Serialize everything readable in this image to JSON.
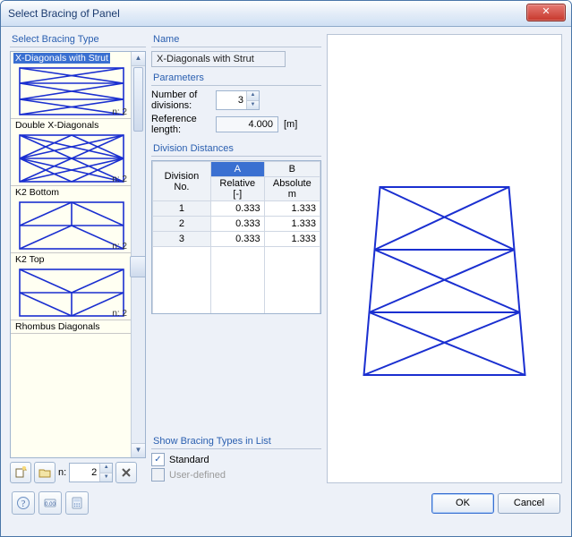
{
  "window": {
    "title": "Select Bracing of Panel",
    "close": "✕"
  },
  "left": {
    "group": "Select Bracing Type",
    "items": [
      {
        "name": "X-Diagonals with Strut",
        "ncount": "n: 2",
        "kind": "xstrut",
        "selected": true
      },
      {
        "name": "Double X-Diagonals",
        "ncount": "n: 2",
        "kind": "dblx"
      },
      {
        "name": "K2 Bottom",
        "ncount": "n: 2",
        "kind": "k2b"
      },
      {
        "name": "K2 Top",
        "ncount": "n: 2",
        "kind": "k2t"
      },
      {
        "name": "Rhombus Diagonals",
        "ncount": "",
        "kind": "rhom"
      }
    ],
    "n_label": "n:",
    "n_value": "2"
  },
  "mid": {
    "name_group": "Name",
    "name_value": "X-Diagonals with Strut",
    "param_group": "Parameters",
    "divisions_label": "Number of divisions:",
    "divisions_value": "3",
    "reflen_label": "Reference length:",
    "reflen_value": "4.000",
    "reflen_unit": "[m]",
    "dd_group": "Division Distances",
    "table": {
      "col_division": "Division No.",
      "col_a": "A",
      "col_b": "B",
      "sub_a": "Relative [-]",
      "sub_b": "Absolute m",
      "rows": [
        {
          "no": "1",
          "a": "0.333",
          "b": "1.333"
        },
        {
          "no": "2",
          "a": "0.333",
          "b": "1.333"
        },
        {
          "no": "3",
          "a": "0.333",
          "b": "1.333"
        }
      ]
    },
    "show_group": "Show Bracing Types in List",
    "cb_standard": "Standard",
    "cb_user": "User-defined"
  },
  "footer": {
    "ok": "OK",
    "cancel": "Cancel"
  }
}
